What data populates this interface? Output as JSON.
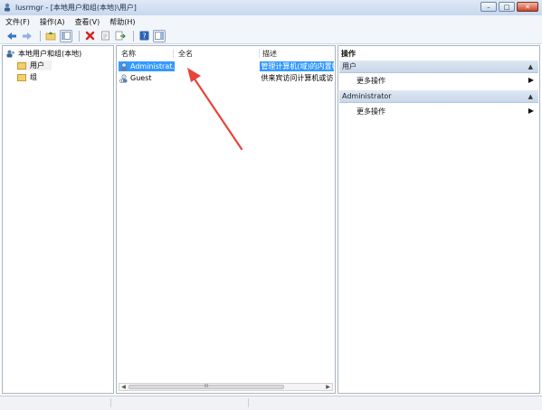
{
  "window": {
    "title": "lusrmgr - [本地用户和组(本地)\\用户]",
    "minimize_glyph": "–",
    "maximize_glyph": "□",
    "close_glyph": "✕"
  },
  "menu": [
    "文件(F)",
    "操作(A)",
    "查看(V)",
    "帮助(H)"
  ],
  "toolbar": {
    "icons": [
      "back-arrow-icon",
      "forward-arrow-icon",
      "up-folder-icon",
      "show-tree-icon",
      "delete-icon",
      "properties-icon",
      "export-icon",
      "help-icon",
      "show-action-pane-icon"
    ]
  },
  "tree": {
    "root_label": "本地用户和组(本地)",
    "nodes": [
      "用户",
      "组"
    ],
    "selected_node": "用户"
  },
  "list": {
    "columns": [
      "名称",
      "全名",
      "描述"
    ],
    "rows": [
      {
        "name": "Administrat...",
        "fullname": "",
        "description": "管理计算机(域)的内置帐",
        "selected": true
      },
      {
        "name": "Guest",
        "fullname": "",
        "description": "供来宾访问计算机或访问",
        "selected": false
      }
    ],
    "scrollbar_grip": "III"
  },
  "actions": {
    "title": "操作",
    "sections": [
      {
        "header": "用户",
        "items": [
          "更多操作"
        ]
      },
      {
        "header": "Administrator",
        "items": [
          "更多操作"
        ]
      }
    ],
    "collapse_glyph": "▲",
    "more_glyph": "▶"
  },
  "colors": {
    "selection": "#3399ff",
    "annotation_arrow": "#e8443a"
  }
}
